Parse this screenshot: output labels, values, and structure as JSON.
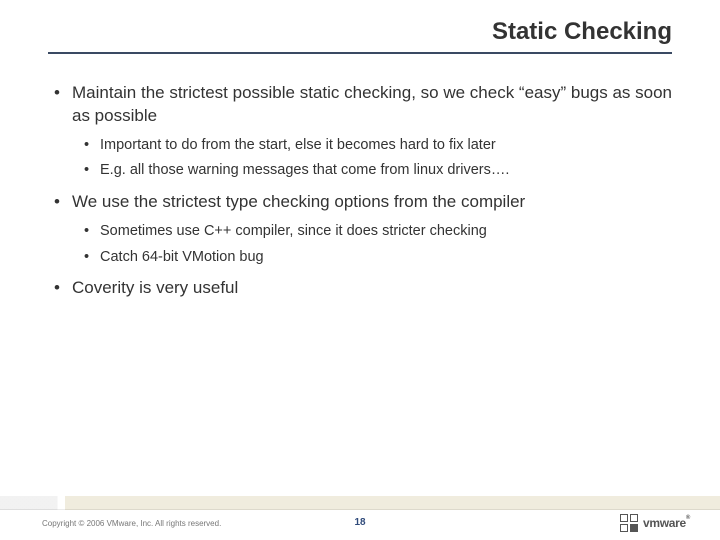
{
  "title": "Static Checking",
  "bullets": [
    {
      "text": "Maintain the strictest possible static checking, so we check “easy” bugs as soon as possible",
      "sub": [
        "Important to do from the start, else it becomes hard to fix later",
        "E.g. all those warning messages that come from linux drivers…."
      ]
    },
    {
      "text": "We use the strictest type checking options from the compiler",
      "sub": [
        "Sometimes use C++ compiler, since it does stricter checking",
        "Catch 64-bit VMotion bug"
      ]
    },
    {
      "text": "Coverity is very useful",
      "sub": []
    }
  ],
  "footer": {
    "copyright": "Copyright © 2006 VMware, Inc. All rights reserved.",
    "page": "18",
    "logo_text": "vmware",
    "logo_reg": "®"
  }
}
